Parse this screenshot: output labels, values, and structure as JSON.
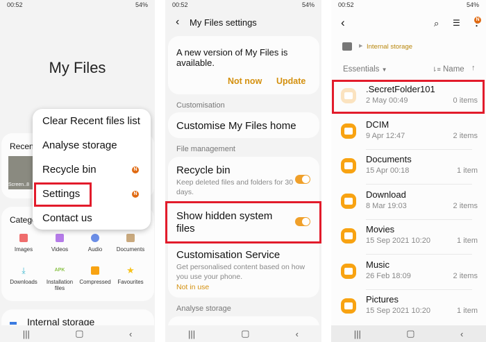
{
  "status": {
    "time": "00:52",
    "right": "54%"
  },
  "p1": {
    "title": "My Files",
    "recent_label": "Recent",
    "thumb_label": "Screen..8",
    "categories_label": "Categories",
    "categories": [
      {
        "label": "Images",
        "color": "#ef6d6d"
      },
      {
        "label": "Videos",
        "color": "#b57be8"
      },
      {
        "label": "Audio",
        "color": "#6a8de6"
      },
      {
        "label": "Documents",
        "color": "#c9a97e"
      },
      {
        "label": "Downloads",
        "color": "#3bb7cf"
      },
      {
        "label": "Installation files",
        "color": "#8bc34a"
      },
      {
        "label": "Compressed",
        "color": "#f8a312"
      },
      {
        "label": "Favourites",
        "color": "#f7c21b"
      }
    ],
    "storage_label": "Internal storage",
    "menu": [
      "Clear Recent files list",
      "Analyse storage",
      "Recycle bin",
      "Settings",
      "Contact us"
    ],
    "badge": "N"
  },
  "p2": {
    "title": "My Files settings",
    "update_text": "A new version of My Files is available.",
    "not_now": "Not now",
    "update": "Update",
    "sec_custom": "Customisation",
    "custom_home": "Customise My Files home",
    "sec_file": "File management",
    "recycle": "Recycle bin",
    "recycle_sub": "Keep deleted files and folders for 30 days.",
    "recycle_on": true,
    "hidden": "Show hidden system files",
    "hidden_on": true,
    "cs": "Customisation Service",
    "cs_sub": "Get personalised content based on how you use your phone.",
    "cs_status": "Not in use",
    "sec_analyse": "Analyse storage"
  },
  "p3": {
    "breadcrumb": "Internal storage",
    "filter": "Essentials",
    "sort": "Name",
    "badge": "N",
    "folders": [
      {
        "name": ".SecretFolder101",
        "date": "2 May 00:49",
        "count": "0 items"
      },
      {
        "name": "DCIM",
        "date": "9 Apr 12:47",
        "count": "2 items"
      },
      {
        "name": "Documents",
        "date": "15 Apr 00:18",
        "count": "1 item"
      },
      {
        "name": "Download",
        "date": "8 Mar 19:03",
        "count": "2 items"
      },
      {
        "name": "Movies",
        "date": "15 Sep 2021 10:20",
        "count": "1 item"
      },
      {
        "name": "Music",
        "date": "26 Feb 18:09",
        "count": "2 items"
      },
      {
        "name": "Pictures",
        "date": "15 Sep 2021 10:20",
        "count": "1 item"
      }
    ]
  },
  "colors": {
    "accent": "#d4900e",
    "highlight": "#e21b2b"
  }
}
